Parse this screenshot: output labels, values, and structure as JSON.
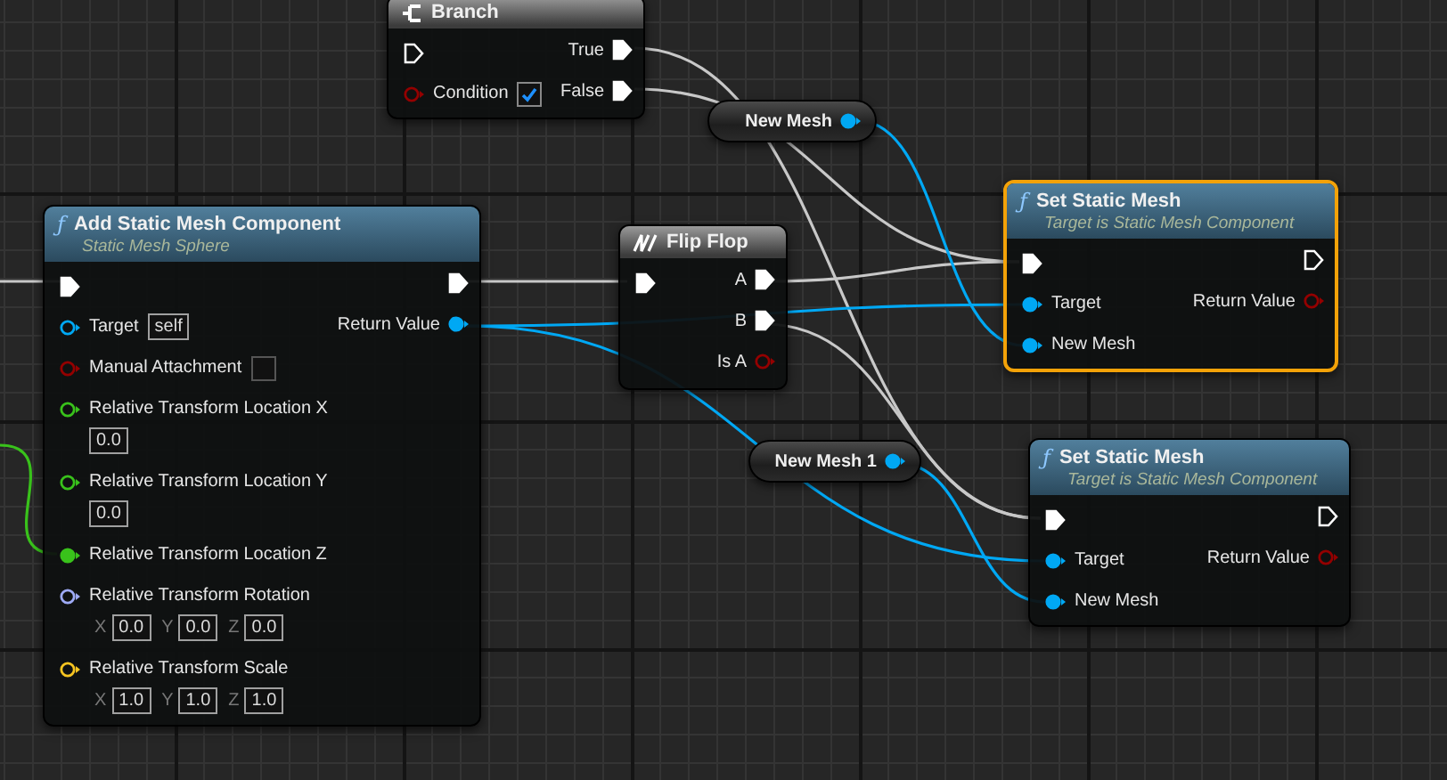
{
  "nodes": [
    {
      "kind": "branch",
      "title": "Branch",
      "selected": false,
      "rows": [
        {
          "left": {
            "kind": "exec",
            "connected": false
          },
          "right": {
            "label": "True",
            "kind": "exec",
            "connected": true
          }
        },
        {
          "left": {
            "label": "Condition",
            "kind": "bool",
            "connected": false,
            "checked": true
          },
          "right": {
            "label": "False",
            "kind": "exec",
            "connected": true
          }
        }
      ]
    },
    {
      "kind": "function",
      "icon": "ƒ",
      "title": "Add Static Mesh Component",
      "subtitle": "Static Mesh Sphere",
      "selected": false,
      "rows": [
        {
          "left": {
            "kind": "exec",
            "connected": true
          },
          "right": {
            "kind": "exec",
            "connected": true
          }
        },
        {
          "left": {
            "label": "Target",
            "kind": "object",
            "connected": false,
            "value": "self"
          },
          "right": {
            "label": "Return Value",
            "kind": "object",
            "connected": true
          }
        },
        {
          "left": {
            "label": "Manual Attachment",
            "kind": "bool",
            "connected": false,
            "checked": false
          }
        },
        {
          "left": {
            "label": "Relative Transform Location X",
            "kind": "float",
            "connected": false,
            "components": [
              {
                "value": "0.0"
              }
            ]
          }
        },
        {
          "left": {
            "label": "Relative Transform Location Y",
            "kind": "float",
            "connected": false,
            "components": [
              {
                "value": "0.0"
              }
            ]
          }
        },
        {
          "left": {
            "label": "Relative Transform Location Z",
            "kind": "float",
            "connected": true
          }
        },
        {
          "left": {
            "label": "Relative Transform Rotation",
            "kind": "rotator",
            "connected": false,
            "components": [
              {
                "axis": "X",
                "value": "0.0"
              },
              {
                "axis": "Y",
                "value": "0.0"
              },
              {
                "axis": "Z",
                "value": "0.0"
              }
            ]
          }
        },
        {
          "left": {
            "label": "Relative Transform Scale",
            "kind": "vector",
            "connected": false,
            "components": [
              {
                "axis": "X",
                "value": "1.0"
              },
              {
                "axis": "Y",
                "value": "1.0"
              },
              {
                "axis": "Z",
                "value": "1.0"
              }
            ]
          }
        }
      ]
    },
    {
      "kind": "macro",
      "title": "Flip Flop",
      "selected": false,
      "rows": [
        {
          "left": {
            "kind": "exec",
            "connected": true
          },
          "right": {
            "label": "A",
            "kind": "exec",
            "connected": true
          }
        },
        {
          "right": {
            "label": "B",
            "kind": "exec",
            "connected": true
          }
        },
        {
          "right": {
            "label": "Is A",
            "kind": "bool",
            "connected": false
          }
        }
      ]
    },
    {
      "kind": "variable",
      "title": "New Mesh",
      "selected": false,
      "pin": {
        "kind": "object",
        "connected": true
      }
    },
    {
      "kind": "function",
      "icon": "ƒ",
      "title": "Set Static Mesh",
      "subtitle": "Target is Static Mesh Component",
      "selected": true,
      "rows": [
        {
          "left": {
            "kind": "exec",
            "connected": true
          },
          "right": {
            "kind": "exec",
            "connected": false
          }
        },
        {
          "left": {
            "label": "Target",
            "kind": "object",
            "connected": true
          },
          "right": {
            "label": "Return Value",
            "kind": "bool",
            "connected": false
          }
        },
        {
          "left": {
            "label": "New Mesh",
            "kind": "object",
            "connected": true
          }
        }
      ]
    },
    {
      "kind": "variable",
      "title": "New Mesh 1",
      "selected": false,
      "pin": {
        "kind": "object",
        "connected": true
      }
    },
    {
      "kind": "function",
      "icon": "ƒ",
      "title": "Set Static Mesh",
      "subtitle": "Target is Static Mesh Component",
      "selected": false,
      "rows": [
        {
          "left": {
            "kind": "exec",
            "connected": true
          },
          "right": {
            "kind": "exec",
            "connected": false
          }
        },
        {
          "left": {
            "label": "Target",
            "kind": "object",
            "connected": true
          },
          "right": {
            "label": "Return Value",
            "kind": "bool",
            "connected": false
          }
        },
        {
          "left": {
            "label": "New Mesh",
            "kind": "object",
            "connected": true
          }
        }
      ]
    }
  ]
}
